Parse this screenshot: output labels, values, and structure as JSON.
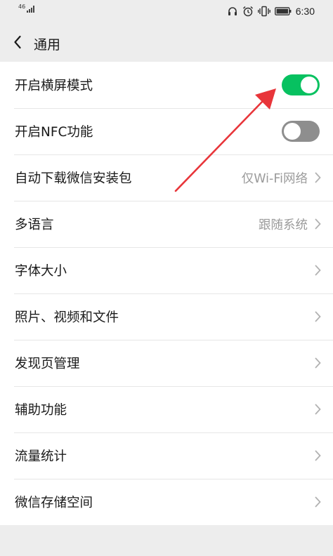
{
  "status_bar": {
    "network": "46",
    "time": "6:30",
    "icons": [
      "headset-icon",
      "alarm-icon",
      "vibrate-icon",
      "battery-icon"
    ]
  },
  "header": {
    "back_icon": "chevron-left-icon",
    "title": "通用"
  },
  "settings": [
    {
      "label": "开启横屏模式",
      "type": "toggle",
      "on": true
    },
    {
      "label": "开启NFC功能",
      "type": "toggle",
      "on": false
    },
    {
      "label": "自动下载微信安装包",
      "type": "link",
      "value": "仅Wi-Fi网络"
    },
    {
      "label": "多语言",
      "type": "link",
      "value": "跟随系统"
    },
    {
      "label": "字体大小",
      "type": "link"
    },
    {
      "label": "照片、视频和文件",
      "type": "link"
    },
    {
      "label": "发现页管理",
      "type": "link"
    },
    {
      "label": "辅助功能",
      "type": "link"
    },
    {
      "label": "流量统计",
      "type": "link"
    },
    {
      "label": "微信存储空间",
      "type": "link"
    }
  ],
  "colors": {
    "toggle_on": "#07c160",
    "toggle_off": "#8e8e8e",
    "annotation_arrow": "#e8353a"
  }
}
